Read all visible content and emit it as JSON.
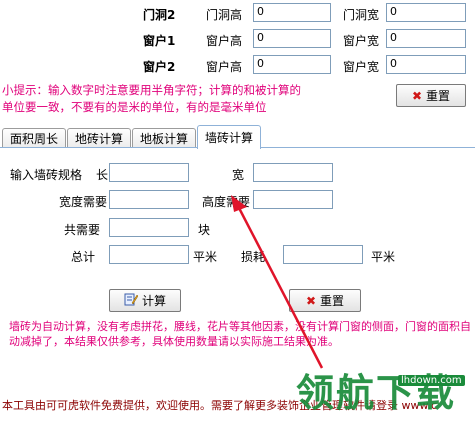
{
  "top_rows": [
    {
      "group": "门洞2",
      "l1": "门洞高",
      "v1": "0",
      "l2": "门洞宽",
      "v2": "0"
    },
    {
      "group": "窗户1",
      "l1": "窗户高",
      "v1": "0",
      "l2": "窗户宽",
      "v2": "0"
    },
    {
      "group": "窗户2",
      "l1": "窗户高",
      "v1": "0",
      "l2": "窗户宽",
      "v2": "0"
    }
  ],
  "hint": {
    "line1": "小提示：输入数字时注意要用半角字符；计算的和被计算的",
    "line2": "单位要一致，不要有的是米的单位，有的是毫米单位"
  },
  "top_reset_label": "重置",
  "tabs": [
    "面积周长",
    "地砖计算",
    "地板计算",
    "墙砖计算"
  ],
  "form": {
    "spec_label": "输入墙砖规格",
    "long_label": "长",
    "wide_label": "宽",
    "width_need_label": "宽度需要",
    "height_need_label": "高度需要",
    "total_need_label": "共需要",
    "unit_block": "块",
    "total_label": "总计",
    "unit_m2_a": "平米",
    "loss_label": "损耗",
    "unit_m2_b": "平米"
  },
  "calc_label": "计算",
  "reset_label": "重置",
  "note": {
    "line1": "墙砖为自动计算，没有考虑拼花，腰线，花片等其他因素，没有计算门窗的侧面，门窗的面积自",
    "line2": "动减掉了，本结果仅供参考，具体使用数量请以实际施工结果为准。"
  },
  "footer": "本工具由可可虎软件免费提供，欢迎使用。需要了解更多装饰企业管理软件请登录 www.c",
  "watermark": {
    "text": "领航下载",
    "url": "lhdown.com"
  },
  "colors": {
    "hint": "#e0007a",
    "arrow": "#e0142a",
    "watermark": "#1a8b3a"
  }
}
